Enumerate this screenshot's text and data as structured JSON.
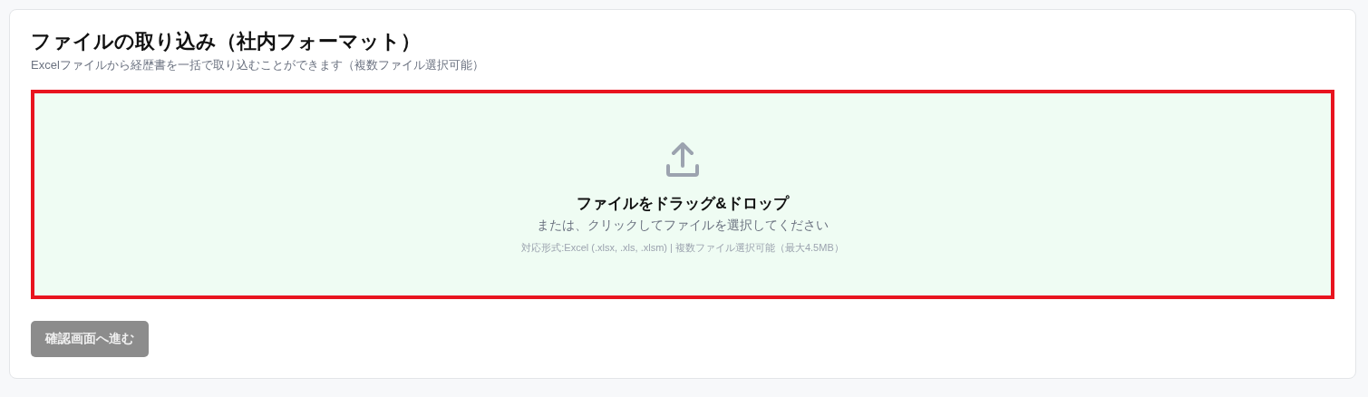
{
  "title": "ファイルの取り込み（社内フォーマット）",
  "subtitle": "Excelファイルから経歴書を一括で取り込むことができます（複数ファイル選択可能）",
  "dropzone": {
    "highlighted": true,
    "heading": "ファイルをドラッグ&ドロップ",
    "instruction": "または、クリックしてファイルを選択してください",
    "note": "対応形式:Excel (.xlsx, .xls, .xlsm) | 複数ファイル選択可能（最大4.5MB）"
  },
  "button": {
    "label": "確認画面へ進む",
    "disabled": true
  }
}
